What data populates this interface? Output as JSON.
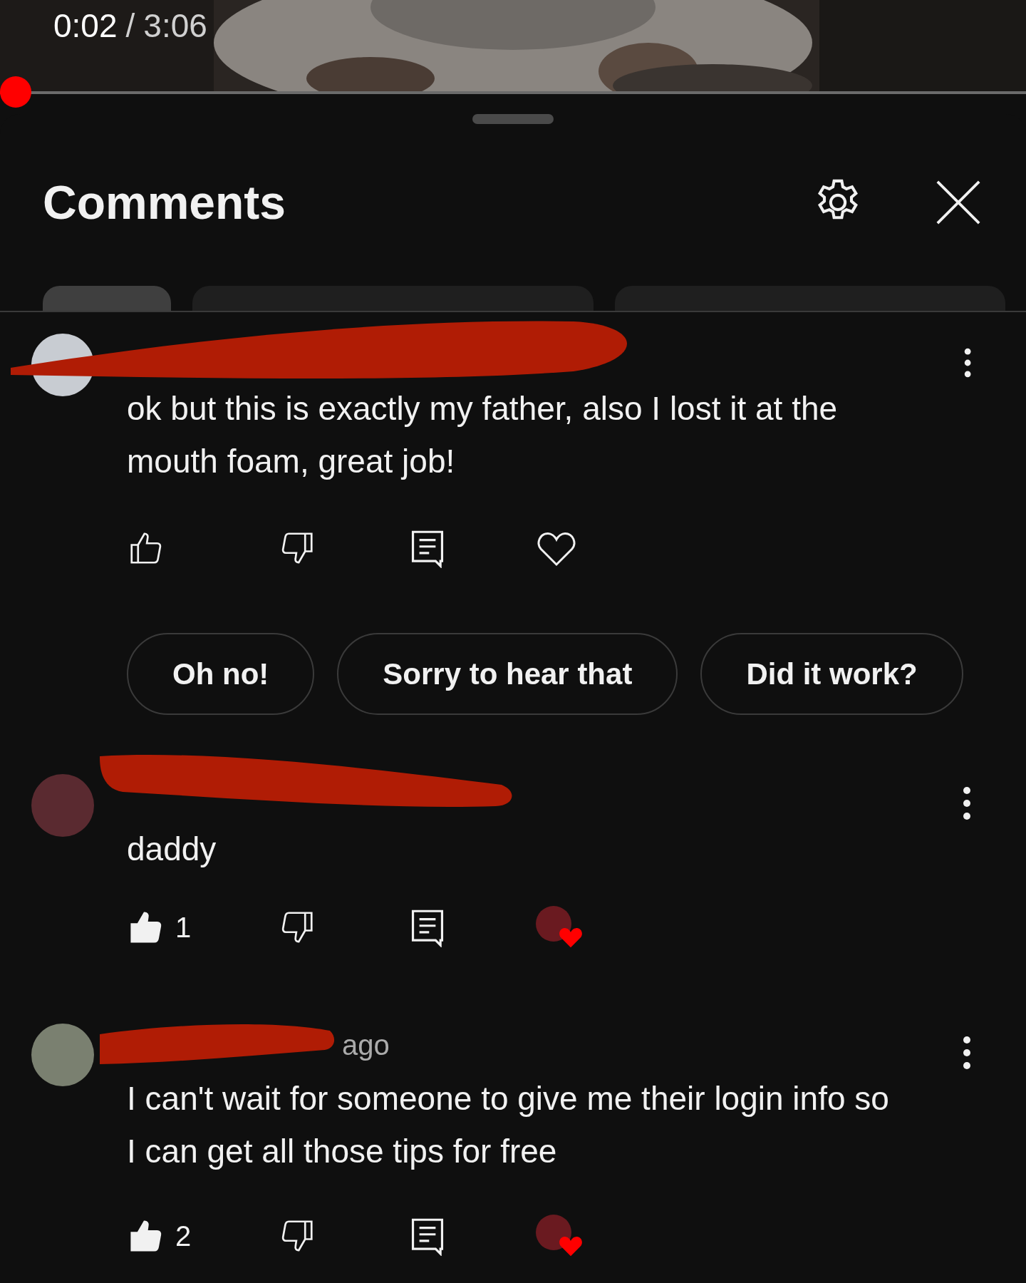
{
  "player": {
    "elapsed": "0:02",
    "separator": "/",
    "duration": "3:06",
    "level": 0.011
  },
  "panel": {
    "title": "Comments"
  },
  "tabs": [
    {
      "selected": true
    },
    {
      "selected": false
    },
    {
      "selected": false
    }
  ],
  "comments": [
    {
      "text": "ok but this is exactly my father, also I lost it at the mouth foam, great job!",
      "liked": false,
      "hearted": false,
      "suggestions": [
        "Oh no!",
        "Sorry to hear that",
        "Did it work?"
      ]
    },
    {
      "text": "daddy",
      "liked": true,
      "likes": "1",
      "hearted": true
    },
    {
      "meta": "ago",
      "text": "I can't wait for someone to give me their login info so I can get all those tips for free",
      "liked": true,
      "likes": "2",
      "hearted": true
    }
  ]
}
